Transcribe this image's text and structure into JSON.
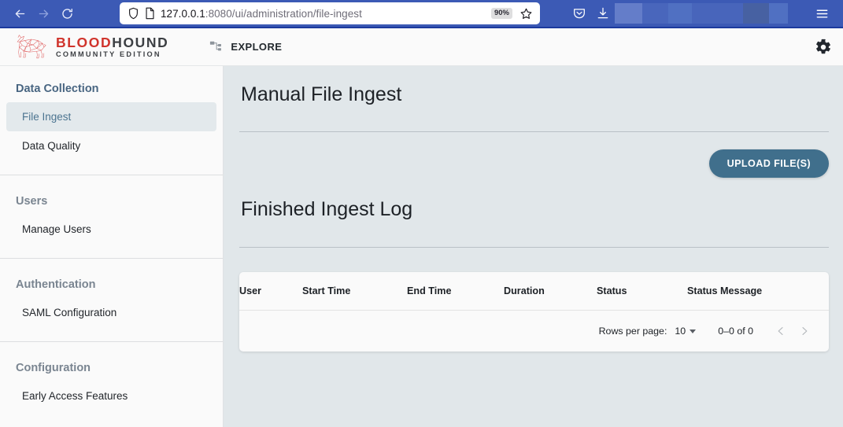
{
  "browser": {
    "back_icon": "arrow-left-icon",
    "forward_icon": "arrow-right-icon",
    "reload_icon": "reload-icon",
    "shield_icon": "shield-icon",
    "page_icon": "page-icon",
    "url_host": "127.0.0.1",
    "url_path": ":8080/ui/administration/file-ingest",
    "url_full": "127.0.0.1:8080/ui/administration/file-ingest",
    "zoom_level": "90%",
    "bookmark_icon": "star-icon",
    "pocket_icon": "pocket-icon",
    "downloads_icon": "download-icon",
    "menu_icon": "hamburger-menu-icon"
  },
  "header": {
    "logo_icon": "bloodhound-dog-logo",
    "logo_word_red": "BLOOD",
    "logo_word_dark": "HOUND",
    "logo_subtitle": "COMMUNITY EDITION",
    "logo_red_color": "#d0342c",
    "explore_icon": "graph-nodes-icon",
    "explore_label": "EXPLORE",
    "settings_icon": "gear-icon"
  },
  "sidebar": {
    "groups": [
      {
        "header": "Data Collection",
        "items": [
          {
            "label": "File Ingest",
            "active": true
          },
          {
            "label": "Data Quality",
            "active": false
          }
        ]
      },
      {
        "header": "Users",
        "items": [
          {
            "label": "Manage Users",
            "active": false
          }
        ]
      },
      {
        "header": "Authentication",
        "items": [
          {
            "label": "SAML Configuration",
            "active": false
          }
        ]
      },
      {
        "header": "Configuration",
        "items": [
          {
            "label": "Early Access Features",
            "active": false
          }
        ]
      }
    ]
  },
  "main": {
    "page_title": "Manual File Ingest",
    "upload_button": "UPLOAD FILE(S)",
    "upload_button_color": "#406f8c",
    "section_title": "Finished Ingest Log",
    "table": {
      "columns": [
        "User",
        "Start Time",
        "End Time",
        "Duration",
        "Status",
        "Status Message"
      ],
      "rows": []
    },
    "pagination": {
      "rows_per_page_label": "Rows per page:",
      "rows_per_page_value": "10",
      "range_label": "0–0 of 0",
      "prev_icon": "chevron-left-icon",
      "next_icon": "chevron-right-icon"
    }
  }
}
